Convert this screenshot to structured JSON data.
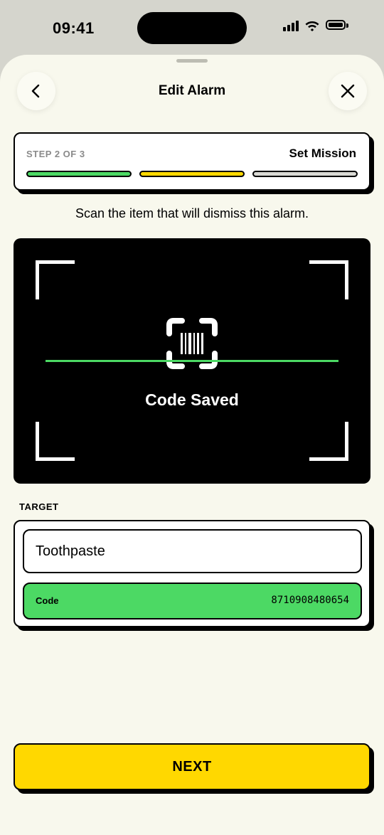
{
  "status_bar": {
    "time": "09:41"
  },
  "header": {
    "title": "Edit Alarm",
    "back_icon": "chevron-left-icon",
    "close_icon": "close-icon"
  },
  "step": {
    "label": "STEP 2 OF 3",
    "name": "Set Mission",
    "current": 2,
    "total": 3,
    "colors": [
      "#4cd964",
      "#ffd800",
      "#d9d9d4"
    ]
  },
  "instruction": "Scan the item that will dismiss this alarm.",
  "scanner": {
    "status": "Code Saved",
    "icon": "barcode-scan-icon",
    "scan_line_color": "#4cd964"
  },
  "target": {
    "section_label": "TARGET",
    "name_value": "Toothpaste",
    "code_label": "Code",
    "code_value": "8710908480654"
  },
  "next_button": {
    "label": "NEXT",
    "color": "#ffd800"
  }
}
